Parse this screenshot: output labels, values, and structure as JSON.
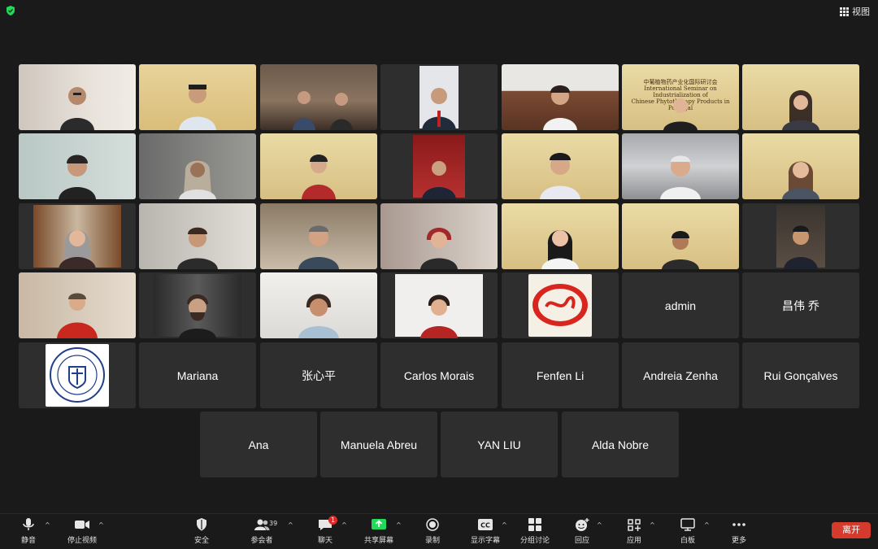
{
  "header": {
    "view_label": "视图"
  },
  "participants_row_names": [
    "admin",
    "昌伟 乔",
    "Mariana",
    "张心平",
    "Carlos Morais",
    "Fenfen Li",
    "Andreia Zenha",
    "Rui Gonçalves",
    "Ana",
    "Manuela Abreu",
    "YAN LIU",
    "Alda Nobre"
  ],
  "banner": {
    "cn_title": "中葡植物药产业化国际研讨会",
    "en_line1": "International Seminar on Industrialization of",
    "en_line2": "Chinese Phytotherapy Products in Portugal"
  },
  "name_tiles": {
    "admin": "admin",
    "chang": "昌伟 乔",
    "mariana": "Mariana",
    "zhang": "张心平",
    "carlos": "Carlos Morais",
    "fenfen": "Fenfen Li",
    "andreia": "Andreia Zenha",
    "rui": "Rui Gonçalves",
    "ana": "Ana",
    "manuela": "Manuela Abreu",
    "yanliu": "YAN LIU",
    "alda": "Alda Nobre"
  },
  "toolbar": {
    "mute": "静音",
    "stop_video": "停止视频",
    "security": "安全",
    "participants": "参会者",
    "participants_count": "39",
    "chat": "聊天",
    "chat_badge": "1",
    "share_screen": "共享屏幕",
    "record": "录制",
    "captions": "显示字幕",
    "captions_icon_text": "CC",
    "breakout": "分组讨论",
    "reactions": "回应",
    "apps": "应用",
    "whiteboard": "白板",
    "more": "更多",
    "leave": "离开"
  },
  "colors": {
    "share_green": "#23d959",
    "leave_red": "#d43b2c",
    "tile_bg": "#2e2e2e",
    "badge_red": "#e02828"
  }
}
